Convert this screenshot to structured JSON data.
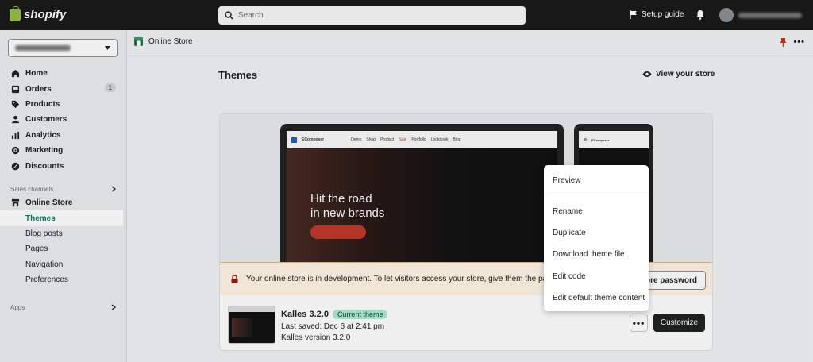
{
  "topbar": {
    "brand": "shopify",
    "search_placeholder": "Search",
    "setup_guide": "Setup guide"
  },
  "sidebar": {
    "main_items": [
      {
        "label": "Home"
      },
      {
        "label": "Orders",
        "badge": "1"
      },
      {
        "label": "Products"
      },
      {
        "label": "Customers"
      },
      {
        "label": "Analytics"
      },
      {
        "label": "Marketing"
      },
      {
        "label": "Discounts"
      }
    ],
    "sales_channels_label": "Sales channels",
    "online_store_label": "Online Store",
    "sub_items": [
      {
        "label": "Themes",
        "active": true
      },
      {
        "label": "Blog posts"
      },
      {
        "label": "Pages"
      },
      {
        "label": "Navigation"
      },
      {
        "label": "Preferences"
      }
    ],
    "apps_label": "Apps"
  },
  "breadcrumb": {
    "label": "Online Store"
  },
  "page": {
    "title": "Themes",
    "view_store": "View your store"
  },
  "preview": {
    "site_brand": "EComposer",
    "nav_links": [
      "Demo",
      "Shop",
      "Product",
      "Sale",
      "Portfolio",
      "Lookbook",
      "Blog"
    ],
    "hero_line1": "Hit the road",
    "hero_line2": "in new brands"
  },
  "banner": {
    "text": "Your online store is in development. To let visitors access your store, give them the passwo",
    "button": "store password"
  },
  "theme": {
    "name": "Kalles 3.2.0",
    "badge": "Current theme",
    "last_saved": "Last saved: Dec 6 at 2:41 pm",
    "version": "Kalles version 3.2.0",
    "more_label": "•••",
    "customize": "Customize"
  },
  "menu": {
    "items": [
      "Preview",
      "Rename",
      "Duplicate",
      "Download theme file",
      "Edit code",
      "Edit default theme content"
    ]
  },
  "colors": {
    "accent": "#008060",
    "topbar": "#1a1a1a",
    "badge_green": "#aee9d1"
  }
}
